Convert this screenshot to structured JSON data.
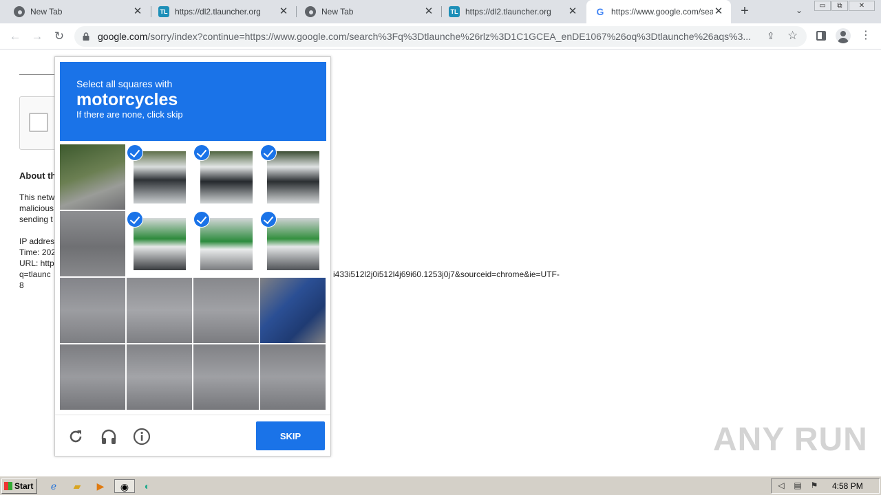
{
  "tabs": [
    {
      "title": "New Tab",
      "favicon": "chrome-icon",
      "active": false
    },
    {
      "title": "https://dl2.tlauncher.org",
      "favicon": "tlauncher-icon",
      "active": false
    },
    {
      "title": "New Tab",
      "favicon": "chrome-icon",
      "active": false
    },
    {
      "title": "https://dl2.tlauncher.org",
      "favicon": "tlauncher-icon",
      "active": false
    },
    {
      "title": "https://www.google.com/search",
      "favicon": "google-icon",
      "active": true
    }
  ],
  "address_bar": {
    "domain": "google.com",
    "path": "/sorry/index?continue=https://www.google.com/search%3Fq%3Dtlaunche%26rlz%3D1C1GCEA_enDE1067%26oq%3Dtlaunche%26aqs%3..."
  },
  "page": {
    "about_heading": "About th",
    "body_lines": [
      "This netw",
      "malicious",
      "sending t"
    ],
    "ip_line": "IP addres",
    "time_line": "Time: 202",
    "url_line": "URL: http",
    "query_line": "q=tlaunc",
    "url_tail": "i433i512l2j0i512l4j69i60.1253j0j7&sourceid=chrome&ie=UTF-",
    "url_tail_2": "8"
  },
  "challenge": {
    "instruction": "Select all squares with",
    "target": "motorcycles",
    "hint": "If there are none, click skip",
    "skip_label": "SKIP",
    "selected_tiles": [
      1,
      2,
      3,
      5,
      6,
      7
    ],
    "footer_icons": [
      "reload-icon",
      "audio-icon",
      "info-icon"
    ]
  },
  "watermark": "ANY RUN",
  "taskbar": {
    "start_label": "Start",
    "clock": "4:58 PM"
  },
  "colors": {
    "accent": "#1a73e8",
    "tab_strip": "#dee1e6",
    "taskbar": "#d4d0c8"
  }
}
